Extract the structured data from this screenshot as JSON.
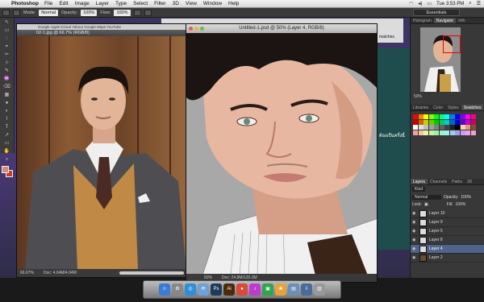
{
  "menubar": {
    "apple": "",
    "app_name": "Photoshop",
    "items": [
      "File",
      "Edit",
      "Image",
      "Layer",
      "Type",
      "Select",
      "Filter",
      "3D",
      "View",
      "Window",
      "Help"
    ],
    "clock": "Tue 3:53 PM"
  },
  "options_bar": {
    "mode_label": "Mode:",
    "mode_value": "Normal",
    "opacity_label": "Opacity:",
    "opacity_value": "100%",
    "flow_label": "Flow:",
    "flow_value": "100%",
    "workspace": "Essentials"
  },
  "browser": {
    "text": "matches"
  },
  "thai_text": "ต้องเป็นครั้งนี้",
  "doc1": {
    "url_fragment": "www.pintrest.com/...Theophilus/...",
    "tabs_text": "Google  Apple  iCloud  Yahoo!  Google Maps  YouTube",
    "title": "02-1.jpg @ 66.7% (RGB/8)",
    "zoom": "66.67%",
    "doc_size": "Doc: 4.04M/4.04M"
  },
  "doc2": {
    "title": "Untitled-1.psd @ 50% (Layer 4, RGB/8)",
    "zoom": "50%",
    "doc_size": "Doc: 24.8M/120.3M"
  },
  "panels": {
    "top_tabs": [
      "Histogram",
      "Navigator",
      "Info"
    ],
    "nav_zoom": "50%",
    "swatch_tabs": [
      "Libraries",
      "Color",
      "Styles",
      "Swatches"
    ],
    "layer_tabs": [
      "Layers",
      "Channels",
      "Paths",
      "3D"
    ],
    "kind_label": "Kind",
    "blend": "Normal",
    "opacity_label": "Opacity:",
    "opacity": "100%",
    "lock_label": "Lock:",
    "fill_label": "Fill:",
    "fill": "100%",
    "layers": [
      {
        "name": "Layer 10",
        "selected": false
      },
      {
        "name": "Layer 9",
        "selected": false
      },
      {
        "name": "Layer 5",
        "selected": false
      },
      {
        "name": "Layer 8",
        "selected": false
      },
      {
        "name": "Layer 4",
        "selected": true
      },
      {
        "name": "Layer 2",
        "selected": false
      }
    ]
  },
  "swatch_colors": [
    "#ff0000",
    "#ff8000",
    "#ffff00",
    "#80ff00",
    "#00ff00",
    "#00ff80",
    "#00ffff",
    "#0080ff",
    "#0000ff",
    "#8000ff",
    "#ff00ff",
    "#ff0080",
    "#cc0000",
    "#cc6600",
    "#cccc00",
    "#66cc00",
    "#00cc00",
    "#00cc66",
    "#00cccc",
    "#0066cc",
    "#0000cc",
    "#6600cc",
    "#cc00cc",
    "#cc0066",
    "#ffffff",
    "#e0e0e0",
    "#c0c0c0",
    "#a0a0a0",
    "#808080",
    "#606060",
    "#404040",
    "#202020",
    "#000000",
    "#f6d2b0",
    "#d8a070",
    "#8a5030",
    "#f0a0a0",
    "#f0c8a0",
    "#f0f0a0",
    "#c8f0a0",
    "#a0f0a0",
    "#a0f0c8",
    "#a0f0f0",
    "#a0c8f0",
    "#a0a0f0",
    "#c8a0f0",
    "#f0a0f0",
    "#f0a0c8"
  ],
  "dock": {
    "apps": [
      {
        "name": "finder",
        "glyph": "☺",
        "color": "#3a7bd5"
      },
      {
        "name": "launchpad",
        "glyph": "⚙",
        "color": "#888888"
      },
      {
        "name": "safari",
        "glyph": "◎",
        "color": "#2f8fd8"
      },
      {
        "name": "mail",
        "glyph": "✉",
        "color": "#6fa0d8"
      },
      {
        "name": "photoshop",
        "glyph": "Ps",
        "color": "#1b3a5c"
      },
      {
        "name": "illustrator",
        "glyph": "Ai",
        "color": "#4a2a0a"
      },
      {
        "name": "chrome",
        "glyph": "●",
        "color": "#d84a3a"
      },
      {
        "name": "itunes",
        "glyph": "♪",
        "color": "#c03ad0"
      },
      {
        "name": "facetime",
        "glyph": "▣",
        "color": "#2ea44f"
      },
      {
        "name": "photos",
        "glyph": "❀",
        "color": "#e7a23a"
      },
      {
        "name": "finder-folder",
        "glyph": "▤",
        "color": "#6a8fb8"
      },
      {
        "name": "downloads",
        "glyph": "⇩",
        "color": "#4a6a9a"
      },
      {
        "name": "trash",
        "glyph": "▥",
        "color": "#999999"
      }
    ]
  },
  "tools": {
    "icons": [
      "↖",
      "▭",
      "◌",
      "⌖",
      "✂",
      "⊹",
      "✎",
      "♒",
      "⌫",
      "▦",
      "●",
      "◐",
      "⌇",
      "T",
      "↗",
      "▭",
      "✋",
      "⌕"
    ]
  }
}
